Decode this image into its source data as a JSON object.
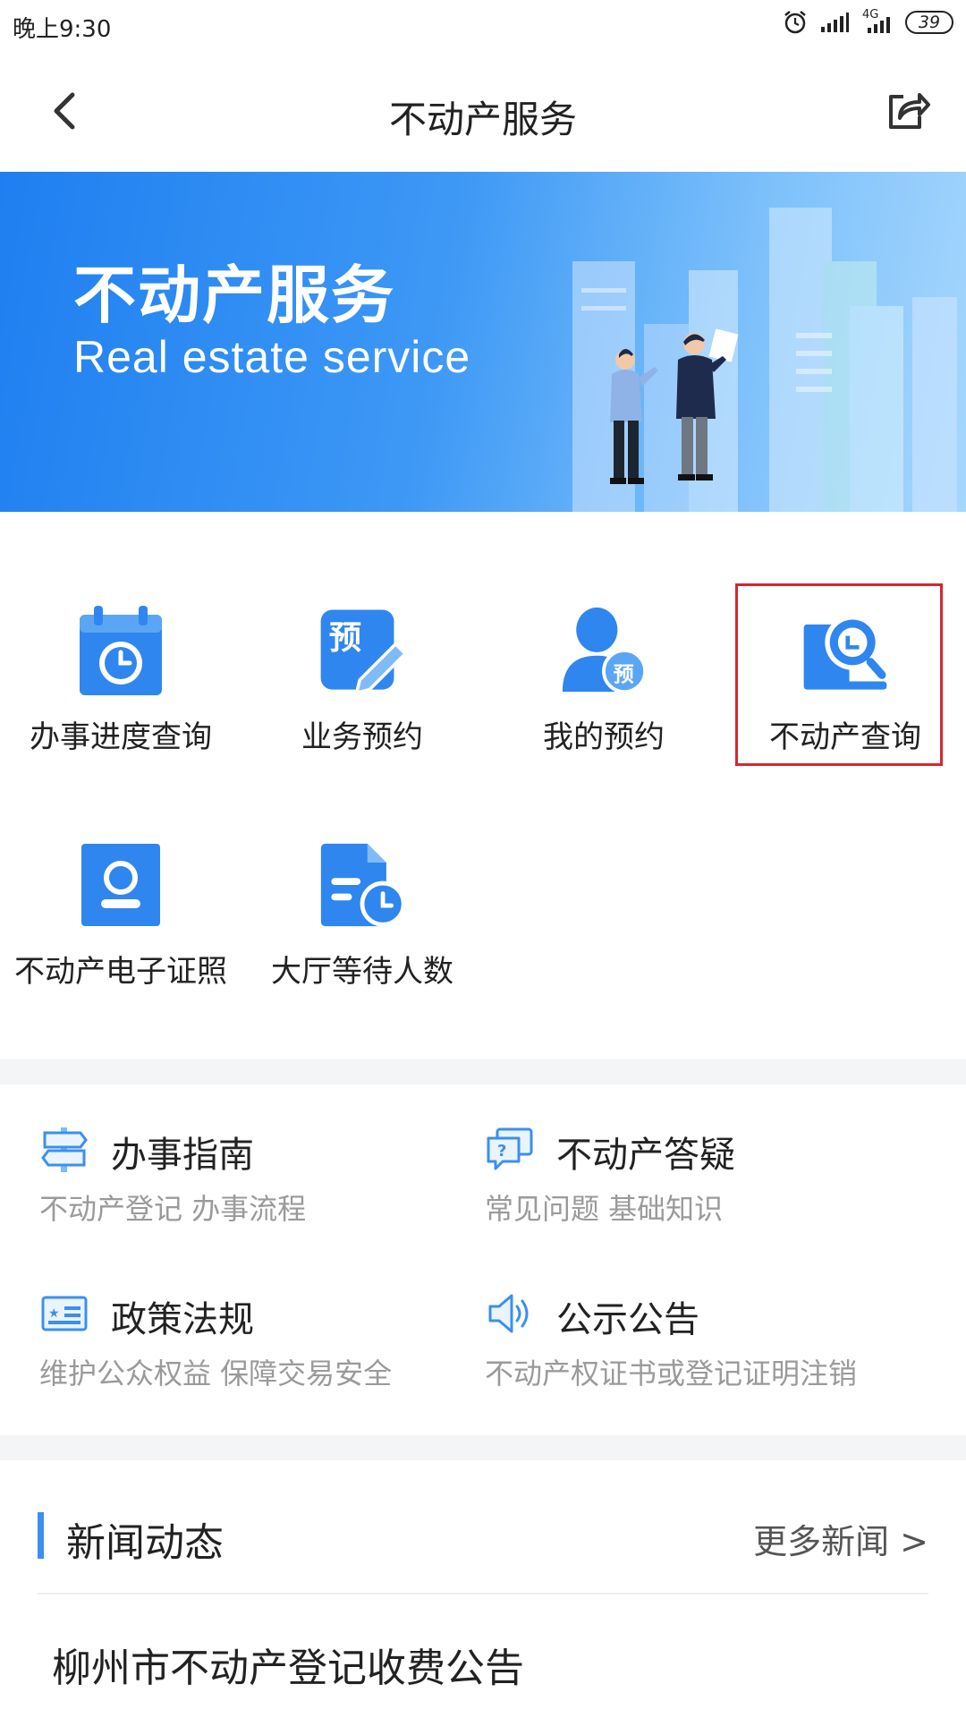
{
  "status_bar": {
    "time": "晚上9:30",
    "network": "4G",
    "battery": "39"
  },
  "nav": {
    "title": "不动产服务",
    "back_icon": "chevron-left-icon",
    "share_icon": "share-icon"
  },
  "banner": {
    "title": "不动产服务",
    "subtitle": "Real estate service"
  },
  "services": [
    {
      "label": "办事进度查询",
      "icon": "calendar-clock-icon"
    },
    {
      "label": "业务预约",
      "icon": "appointment-edit-icon"
    },
    {
      "label": "我的预约",
      "icon": "user-appointment-icon"
    },
    {
      "label": "不动产查询",
      "icon": "magnifier-search-icon"
    },
    {
      "label": "不动产电子证照",
      "icon": "id-card-icon"
    },
    {
      "label": "大厅等待人数",
      "icon": "document-clock-icon"
    }
  ],
  "info": [
    {
      "title": "办事指南",
      "subtitle": "不动产登记 办事流程",
      "icon": "signpost-icon"
    },
    {
      "title": "不动产答疑",
      "subtitle": "常见问题 基础知识",
      "icon": "question-chat-icon"
    },
    {
      "title": "政策法规",
      "subtitle": "维护公众权益 保障交易安全",
      "icon": "policy-card-icon"
    },
    {
      "title": "公示公告",
      "subtitle": "不动产权证书或登记证明注销",
      "icon": "speaker-icon"
    }
  ],
  "news": {
    "title": "新闻动态",
    "more": "更多新闻 >",
    "items": [
      "柳州市不动产登记收费公告"
    ]
  },
  "colors": {
    "accent": "#3a8ff0",
    "highlight_border": "#d7262d",
    "icon_blue": "#2f86ee"
  }
}
